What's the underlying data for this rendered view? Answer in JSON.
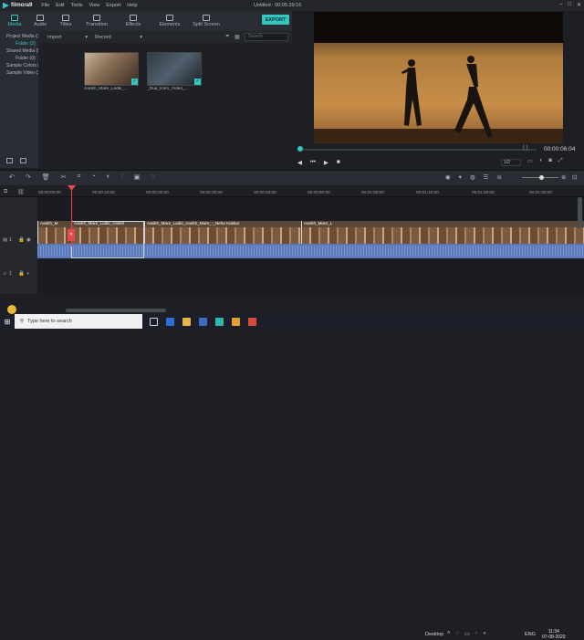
{
  "app": {
    "name": "filmora9",
    "menus": [
      "File",
      "Edit",
      "Tools",
      "View",
      "Export",
      "Help"
    ],
    "window_title": "Untitled : 00:05:39:16"
  },
  "tabs": [
    {
      "label": "Media",
      "active": true
    },
    {
      "label": "Audio",
      "active": false
    },
    {
      "label": "Titles",
      "active": false
    },
    {
      "label": "Transition",
      "active": false
    },
    {
      "label": "Effects",
      "active": false
    },
    {
      "label": "Elements",
      "active": false
    },
    {
      "label": "Split Screen",
      "active": false
    }
  ],
  "export_label": "EXPORT",
  "sidebar": {
    "items": [
      {
        "label": "Project Media (2)"
      },
      {
        "label": "Folder (2)"
      },
      {
        "label": "Shared Media (0)"
      },
      {
        "label": "Folder (0)"
      },
      {
        "label": "Sample Colors (15)"
      },
      {
        "label": "Sample Video (20)"
      }
    ]
  },
  "media_toolbar": {
    "import_label": "Import",
    "record_label": "Record",
    "search_placeholder": "Search"
  },
  "media_items": [
    {
      "label": "Aankh_Mare_Ladki_..."
    },
    {
      "label": "_Dua_Karo_Video_..."
    }
  ],
  "preview": {
    "timecode": "00:00:06:04",
    "ratio": "1/2"
  },
  "ruler_ticks": [
    "00:00:00:00",
    "00:00:10:00",
    "00:00:20:00",
    "00:00:30:00",
    "00:00:40:00",
    "00:00:50:00",
    "00:01:00:00",
    "00:01:10:00",
    "00:01:20:00",
    "00:01:30:00"
  ],
  "clips": [
    {
      "label": "Aankh_M"
    },
    {
      "label": "Aankh_Mare_Ladki_Aankh"
    },
    {
      "label": "Aankh_Mare_Ladki_Aankh_Mare_-_Neha Kakkar"
    },
    {
      "label": "Aankh_Mare_L"
    }
  ],
  "tracks": {
    "video_label": "1",
    "audio_label": "1"
  },
  "taskbar": {
    "search_placeholder": "Type here to search",
    "tray_label": "Desktop",
    "lang": "ENG",
    "time": "11:34",
    "date": "07-08-2020"
  }
}
